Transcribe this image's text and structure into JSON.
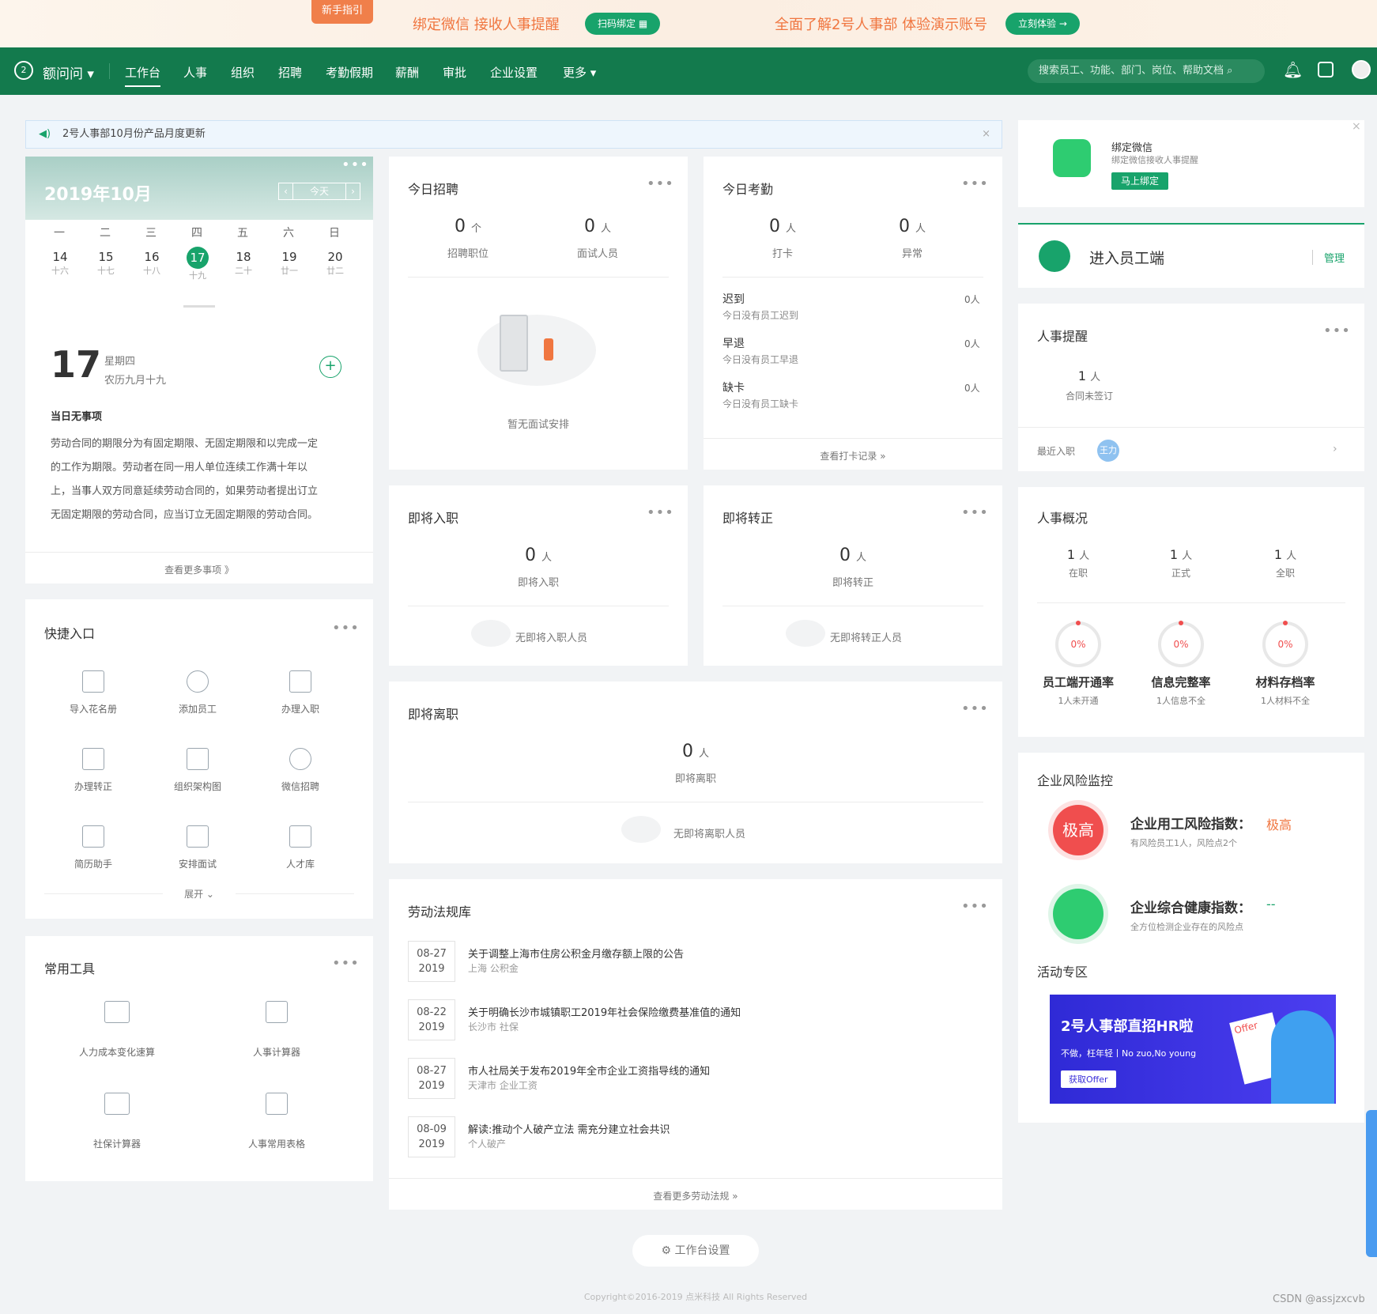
{
  "promo": {
    "guide_tag": "新手指引",
    "text1": "绑定微信  接收人事提醒",
    "btn1": "扫码绑定 ▦",
    "text2": "全面了解2号人事部  体验演示账号",
    "btn2": "立刻体验 →"
  },
  "nav": {
    "brand": "额问问",
    "items": [
      "工作台",
      "人事",
      "组织",
      "招聘",
      "考勤假期",
      "薪酬",
      "审批",
      "企业设置",
      "更多"
    ],
    "search_placeholder": "搜索员工、功能、部门、岗位、帮助文档"
  },
  "notice": {
    "text": "2号人事部10月份产品月度更新"
  },
  "calendar": {
    "month": "2019年10月",
    "today_btn": "今天",
    "weekdays": [
      "一",
      "二",
      "三",
      "四",
      "五",
      "六",
      "日"
    ],
    "days": [
      {
        "d": "14",
        "l": "十六"
      },
      {
        "d": "15",
        "l": "十七"
      },
      {
        "d": "16",
        "l": "十八"
      },
      {
        "d": "17",
        "l": "十九"
      },
      {
        "d": "18",
        "l": "二十"
      },
      {
        "d": "19",
        "l": "廿一"
      },
      {
        "d": "20",
        "l": "廿二"
      }
    ],
    "big_day": "17",
    "weekday": "星期四",
    "lunar": "农历九月十九",
    "no_event": "当日无事项",
    "law_text_lines": [
      "劳动合同的期限分为有固定期限、无固定期限和以完成一定",
      "的工作为期限。劳动者在同一用人单位连续工作满十年以",
      "上，当事人双方同意延续劳动合同的，如果劳动者提出订立",
      "无固定期限的劳动合同，应当订立无固定期限的劳动合同。"
    ],
    "more": "查看更多事项 》"
  },
  "recruit": {
    "title": "今日招聘",
    "a_num": "0",
    "a_unit": "个",
    "a_label": "招聘职位",
    "b_num": "0",
    "b_unit": "人",
    "b_label": "面试人员",
    "empty": "暂无面试安排"
  },
  "attendance": {
    "title": "今日考勤",
    "a_num": "0",
    "a_unit": "人",
    "a_label": "打卡",
    "b_num": "0",
    "b_unit": "人",
    "b_label": "异常",
    "rows": [
      {
        "name": "迟到",
        "desc": "今日没有员工迟到",
        "val": "0人"
      },
      {
        "name": "早退",
        "desc": "今日没有员工早退",
        "val": "0人"
      },
      {
        "name": "缺卡",
        "desc": "今日没有员工缺卡",
        "val": "0人"
      }
    ],
    "link": "查看打卡记录 »"
  },
  "onboard": {
    "title": "即将入职",
    "num": "0",
    "unit": "人",
    "label": "即将入职",
    "empty": "无即将入职人员"
  },
  "regular": {
    "title": "即将转正",
    "num": "0",
    "unit": "人",
    "label": "即将转正",
    "empty": "无即将转正人员"
  },
  "leave": {
    "title": "即将离职",
    "num": "0",
    "unit": "人",
    "label": "即将离职",
    "empty": "无即将离职人员"
  },
  "quick": {
    "title": "快捷入口",
    "items": [
      "导入花名册",
      "添加员工",
      "办理入职",
      "办理转正",
      "组织架构图",
      "微信招聘",
      "简历助手",
      "安排面试",
      "人才库"
    ],
    "expand": "展开 ⌄"
  },
  "tools": {
    "title": "常用工具",
    "items": [
      "人力成本变化速算",
      "人事计算器",
      "社保计算器",
      "人事常用表格"
    ]
  },
  "laws": {
    "title": "劳动法规库",
    "items": [
      {
        "md": "08-27",
        "y": "2019",
        "t": "关于调整上海市住房公积金月缴存额上限的公告",
        "s": "上海 公积金"
      },
      {
        "md": "08-22",
        "y": "2019",
        "t": "关于明确长沙市城镇职工2019年社会保险缴费基准值的通知",
        "s": "长沙市 社保"
      },
      {
        "md": "08-27",
        "y": "2019",
        "t": "市人社局关于发布2019年全市企业工资指导线的通知",
        "s": "天津市 企业工资"
      },
      {
        "md": "08-09",
        "y": "2019",
        "t": "解读:推动个人破产立法 需充分建立社会共识",
        "s": "个人破产"
      }
    ],
    "more": "查看更多劳动法规 »"
  },
  "wechat": {
    "title": "绑定微信",
    "desc": "绑定微信接收人事提醒",
    "btn": "马上绑定"
  },
  "employee_portal": {
    "title": "进入员工端",
    "manage": "管理"
  },
  "hr_reminder": {
    "title": "人事提醒",
    "num": "1",
    "unit": "人",
    "label": "合同未签订",
    "recent": "最近入职",
    "avatar": "王力"
  },
  "hr_overview": {
    "title": "人事概况",
    "stats": [
      {
        "num": "1",
        "unit": "人",
        "label": "在职"
      },
      {
        "num": "1",
        "unit": "人",
        "label": "正式"
      },
      {
        "num": "1",
        "unit": "人",
        "label": "全职"
      }
    ],
    "rates": [
      {
        "pct": "0%",
        "name": "员工端开通率",
        "sub": "1人未开通"
      },
      {
        "pct": "0%",
        "name": "信息完整率",
        "sub": "1人信息不全"
      },
      {
        "pct": "0%",
        "name": "材料存档率",
        "sub": "1人材料不全"
      }
    ]
  },
  "risk": {
    "title": "企业风险监控",
    "risk_badge": "极高",
    "risk_name": "企业用工风险指数：",
    "risk_level": "极高",
    "risk_sub": "有风险员工1人，风险点2个",
    "health_name": "企业综合健康指数：",
    "health_level": "--",
    "health_sub": "全方位检测企业存在的风险点",
    "activity_title": "活动专区",
    "banner_title": "2号人事部直招HR啦",
    "banner_sub": "不做，枉年轻丨No zuo,No young",
    "banner_btn": "获取Offer",
    "banner_tag": "Offer"
  },
  "footer": {
    "settings": "工作台设置",
    "copyright": "Copyright©2016-2019 点米科技 All Rights Reserved",
    "watermark": "CSDN @assjzxcvb"
  },
  "colors": {
    "brand_green": "#137a4d",
    "accent": "#18a36b",
    "orange": "#f07640",
    "danger": "#f04e4e"
  }
}
